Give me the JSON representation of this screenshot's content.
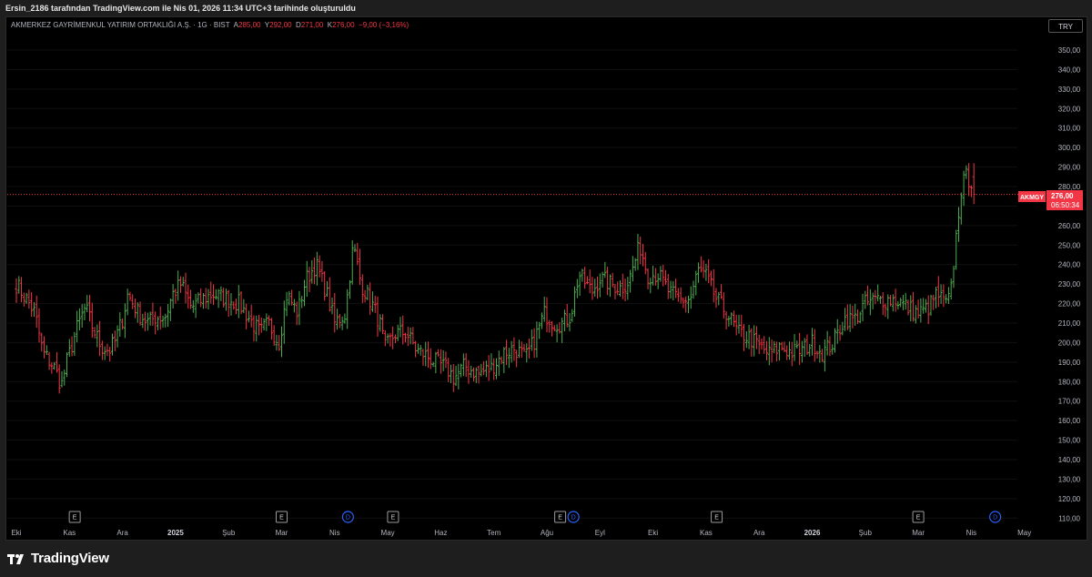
{
  "header": {
    "attribution": "Ersin_2186 tarafından TradingView.com ile Nis 01, 2026 11:34 UTC+3 tarihinde oluşturuldu"
  },
  "legend": {
    "symbol_desc": "AKMERKEZ GAYRİMENKUL YATIRIM ORTAKLIĞI A.Ş. · 1G · BIST",
    "open_label": "A",
    "open": "285,00",
    "high_label": "Y",
    "high": "292,00",
    "low_label": "D",
    "low": "271,00",
    "close_label": "K",
    "close": "276,00",
    "change": "−9,00 (−3,16%)"
  },
  "currency_button": "TRY",
  "price_tag": {
    "ticker": "AKMGY",
    "price": "276,00",
    "countdown": "06:50:34"
  },
  "brand": {
    "name": "TradingView"
  },
  "colors": {
    "up": "#4caf50",
    "down": "#f23645",
    "background": "#000000",
    "last_price_line": "#f23645",
    "event_dividend": "#2962ff"
  },
  "chart_data": {
    "type": "ohlc",
    "symbol": "AKMGY",
    "interval": "1G",
    "currency": "TRY",
    "y_ticks": [
      "110,00",
      "120,00",
      "130,00",
      "140,00",
      "150,00",
      "160,00",
      "170,00",
      "180,00",
      "190,00",
      "200,00",
      "210,00",
      "220,00",
      "230,00",
      "240,00",
      "250,00",
      "260,00",
      "270,00",
      "280,00",
      "290,00",
      "300,00",
      "310,00",
      "320,00",
      "330,00",
      "340,00",
      "350,00"
    ],
    "ylim": [
      105,
      357
    ],
    "x_ticks": [
      {
        "label": "Eki",
        "bold": false
      },
      {
        "label": "Kas",
        "bold": false
      },
      {
        "label": "Ara",
        "bold": false
      },
      {
        "label": "2025",
        "bold": true
      },
      {
        "label": "Şub",
        "bold": false
      },
      {
        "label": "Mar",
        "bold": false
      },
      {
        "label": "Nis",
        "bold": false
      },
      {
        "label": "May",
        "bold": false
      },
      {
        "label": "Haz",
        "bold": false
      },
      {
        "label": "Tem",
        "bold": false
      },
      {
        "label": "Ağu",
        "bold": false
      },
      {
        "label": "Eyl",
        "bold": false
      },
      {
        "label": "Eki",
        "bold": false
      },
      {
        "label": "Kas",
        "bold": false
      },
      {
        "label": "Ara",
        "bold": false
      },
      {
        "label": "2026",
        "bold": true
      },
      {
        "label": "Şub",
        "bold": false
      },
      {
        "label": "Mar",
        "bold": false
      },
      {
        "label": "Nis",
        "bold": false
      },
      {
        "label": "May",
        "bold": false
      }
    ],
    "events": [
      {
        "type": "E",
        "month_pos": 1.1
      },
      {
        "type": "E",
        "month_pos": 5.0
      },
      {
        "type": "D",
        "month_pos": 6.25
      },
      {
        "type": "E",
        "month_pos": 7.1
      },
      {
        "type": "E",
        "month_pos": 10.25
      },
      {
        "type": "D",
        "month_pos": 10.5
      },
      {
        "type": "E",
        "month_pos": 13.2
      },
      {
        "type": "E",
        "month_pos": 17.0
      },
      {
        "type": "D",
        "month_pos": 18.45
      }
    ],
    "last_price": 276,
    "last_open": 285,
    "last_high": 292,
    "last_low": 271,
    "price_path": [
      [
        0.0,
        230
      ],
      [
        0.2,
        222
      ],
      [
        0.35,
        215
      ],
      [
        0.5,
        195
      ],
      [
        0.7,
        188
      ],
      [
        0.85,
        178
      ],
      [
        0.95,
        190
      ],
      [
        1.15,
        208
      ],
      [
        1.3,
        218
      ],
      [
        1.45,
        207
      ],
      [
        1.6,
        198
      ],
      [
        1.75,
        196
      ],
      [
        1.85,
        200
      ],
      [
        2.0,
        212
      ],
      [
        2.1,
        225
      ],
      [
        2.3,
        215
      ],
      [
        2.5,
        210
      ],
      [
        2.6,
        213
      ],
      [
        2.8,
        213
      ],
      [
        2.95,
        225
      ],
      [
        3.1,
        230
      ],
      [
        3.3,
        218
      ],
      [
        3.5,
        222
      ],
      [
        3.7,
        225
      ],
      [
        4.0,
        222
      ],
      [
        4.2,
        220
      ],
      [
        4.45,
        210
      ],
      [
        4.6,
        205
      ],
      [
        4.75,
        210
      ],
      [
        4.95,
        200
      ],
      [
        5.1,
        225
      ],
      [
        5.3,
        215
      ],
      [
        5.45,
        232
      ],
      [
        5.65,
        240
      ],
      [
        5.85,
        225
      ],
      [
        6.0,
        210
      ],
      [
        6.2,
        215
      ],
      [
        6.35,
        250
      ],
      [
        6.5,
        230
      ],
      [
        6.7,
        220
      ],
      [
        6.85,
        210
      ],
      [
        6.95,
        197
      ],
      [
        7.15,
        205
      ],
      [
        7.35,
        205
      ],
      [
        7.55,
        196
      ],
      [
        7.75,
        193
      ],
      [
        7.9,
        190
      ],
      [
        8.1,
        187
      ],
      [
        8.25,
        182
      ],
      [
        8.45,
        188
      ],
      [
        8.7,
        184
      ],
      [
        8.95,
        187
      ],
      [
        9.2,
        195
      ],
      [
        9.4,
        197
      ],
      [
        9.6,
        192
      ],
      [
        9.75,
        200
      ],
      [
        9.95,
        215
      ],
      [
        10.15,
        210
      ],
      [
        10.3,
        210
      ],
      [
        10.45,
        214
      ],
      [
        10.6,
        235
      ],
      [
        10.85,
        226
      ],
      [
        11.0,
        233
      ],
      [
        11.2,
        230
      ],
      [
        11.4,
        228
      ],
      [
        11.55,
        232
      ],
      [
        11.75,
        250
      ],
      [
        11.9,
        235
      ],
      [
        12.1,
        235
      ],
      [
        12.3,
        226
      ],
      [
        12.5,
        222
      ],
      [
        12.7,
        222
      ],
      [
        12.85,
        237
      ],
      [
        13.0,
        234
      ],
      [
        13.2,
        222
      ],
      [
        13.4,
        215
      ],
      [
        13.6,
        205
      ],
      [
        13.8,
        203
      ],
      [
        14.0,
        198
      ],
      [
        14.2,
        194
      ],
      [
        14.4,
        198
      ],
      [
        14.6,
        195
      ],
      [
        14.8,
        196
      ],
      [
        15.0,
        200
      ],
      [
        15.2,
        195
      ],
      [
        15.4,
        200
      ],
      [
        15.6,
        212
      ],
      [
        15.8,
        212
      ],
      [
        16.0,
        220
      ],
      [
        16.2,
        222
      ],
      [
        16.4,
        222
      ],
      [
        16.6,
        222
      ],
      [
        16.8,
        218
      ],
      [
        17.0,
        215
      ],
      [
        17.2,
        218
      ],
      [
        17.35,
        225
      ],
      [
        17.5,
        220
      ],
      [
        17.6,
        222
      ],
      [
        17.7,
        250
      ],
      [
        17.8,
        278
      ],
      [
        17.9,
        285
      ],
      [
        18.0,
        283
      ],
      [
        18.08,
        276
      ]
    ]
  }
}
